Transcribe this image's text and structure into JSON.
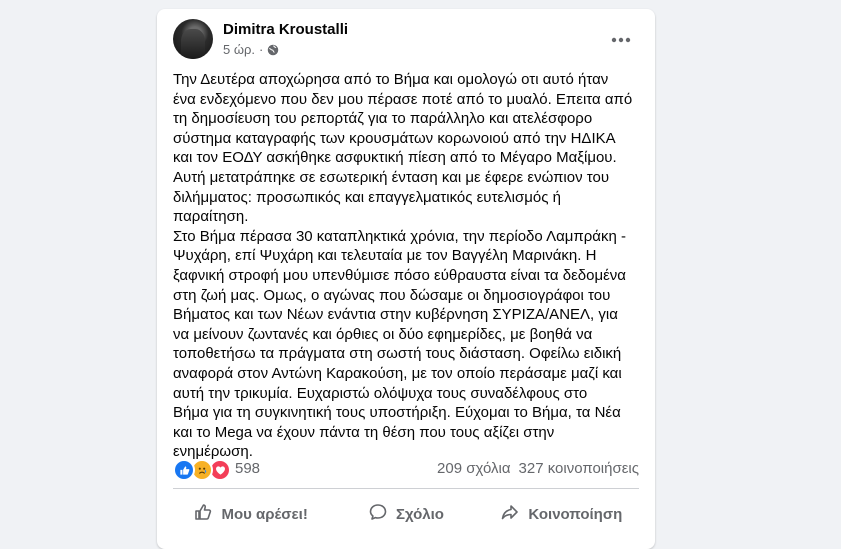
{
  "post": {
    "author": "Dimitra Kroustalli",
    "time": "5 ώρ.",
    "separator": "·",
    "privacy_icon": "globe-icon",
    "more_icon": "more-horizontal-icon",
    "text": "Την Δευτέρα αποχώρησα από το Βήμα και ομολογώ οτι αυτό ήταν\nένα ενδεχόμενο που δεν μου πέρασε ποτέ από το μυαλό. Επειτα από\nτη δημοσίευση του ρεπορτάζ για το παράλληλο και ατελέσφορο\nσύστημα καταγραφής των κρουσμάτων κορωνοιού από την ΗΔΙΚΑ\nκαι τον ΕΟΔΥ ασκήθηκε ασφυκτική πίεση από το Μέγαρο Μαξίμου.\nΑυτή μετατράπηκε σε εσωτερική ένταση και με έφερε ενώπιον του\nδιλήμματος: προσωπικός και επαγγελματικός ευτελισμός ή\nπαραίτηση.\nΣτο Βήμα πέρασα 30 καταπληκτικά χρόνια, την περίοδο Λαμπράκη -\nΨυχάρη, επί Ψυχάρη και τελευταία με τον Βαγγέλη Μαρινάκη. Η\nξαφνική στροφή μου υπενθύμισε πόσο εύθραυστα είναι τα δεδομένα\nστη ζωή μας. Ομως, ο αγώνας που δώσαμε οι δημοσιογράφοι του\nΒήματος και των Νέων ενάντια στην κυβέρνηση ΣΥΡΙΖΑ/ΑΝΕΛ, για\nνα μείνουν ζωντανές και όρθιες οι δύο εφημερίδες, με βοηθά να\nτοποθετήσω τα πράγματα στη σωστή τους διάσταση. Οφείλω ειδική\nαναφορά στον Αντώνη Καρακούση, με τον οποίο περάσαμε μαζί και\nαυτή την τρικυμία. Ευχαριστώ ολόψυχα τους συναδέλφους στο\nΒήμα για τη συγκινητική τους υποστήριξη. Εύχομαι το Βήμα, τα Νέα\nκαι το Mega να έχουν πάντα τη θέση που τους αξίζει στην\nενημέρωση."
  },
  "reactions": {
    "count": "598",
    "icons": [
      "like-icon",
      "sad-icon",
      "love-icon"
    ],
    "comments": "209 σχόλια",
    "shares": "327 κοινοποιήσεις"
  },
  "actions": {
    "like": "Μου αρέσει!",
    "comment": "Σχόλιο",
    "share": "Κοινοποίηση"
  },
  "colors": {
    "background": "#f0f2f5",
    "card": "#ffffff",
    "text": "#050505",
    "secondary_text": "#65676b",
    "like_blue": "#1877f2",
    "love_red": "#f33e58",
    "sad_yellow": "#f7b125"
  }
}
